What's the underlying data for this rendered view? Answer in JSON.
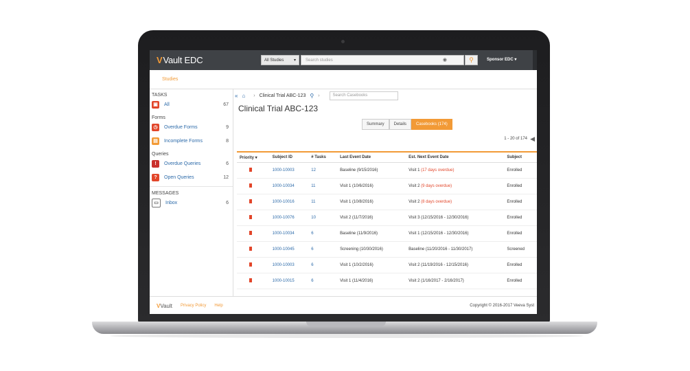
{
  "header": {
    "logo_mark": "V",
    "app_name": "Vault EDC",
    "study_select": "All Studies",
    "search_placeholder": "Search studies",
    "user_menu": "Sponsor EDC ▾"
  },
  "nav": {
    "studies": "Studies"
  },
  "sidebar": {
    "tasks_heading": "TASKS",
    "all": {
      "label": "All",
      "count": "67"
    },
    "forms_heading": "Forms",
    "overdue_forms": {
      "label": "Overdue Forms",
      "count": "9"
    },
    "incomplete_forms": {
      "label": "Incomplete Forms",
      "count": "8"
    },
    "queries_heading": "Queries",
    "overdue_queries": {
      "label": "Overdue Queries",
      "count": "6"
    },
    "open_queries": {
      "label": "Open Queries",
      "count": "12"
    },
    "messages_heading": "MESSAGES",
    "inbox": {
      "label": "Inbox",
      "count": "6"
    },
    "icon_colors": {
      "all": "#e2462a",
      "forms": "#e2462a",
      "incomplete": "#f29a36",
      "queries": "#c9302c",
      "inbox": "#777777"
    }
  },
  "breadcrumb": {
    "study": "Clinical Trial ABC-123",
    "case_search_placeholder": "Search Casebooks"
  },
  "page": {
    "title": "Clinical Trial ABC-123"
  },
  "tabs": {
    "summary": "Summary",
    "details": "Details",
    "casebooks": "Casebooks (174)"
  },
  "pager": {
    "text": "1 - 20 of 174"
  },
  "table": {
    "headers": [
      "Priority ▾",
      "Subject ID",
      "# Tasks",
      "Last Event Date",
      "Est. Next Event Date",
      "Subject"
    ],
    "rows": [
      {
        "id": "1000-10003",
        "tasks": "12",
        "last": "Baseline (9/15/2016)",
        "next": "Visit 1",
        "overdue": "(17 days overdue)",
        "status": "Enrolled"
      },
      {
        "id": "1000-10034",
        "tasks": "11",
        "last": "Visit 1 (10/6/2016)",
        "next": "Visit 2",
        "overdue": "(9 days overdue)",
        "status": "Enrolled"
      },
      {
        "id": "1000-10016",
        "tasks": "11",
        "last": "Visit 1 (10/8/2016)",
        "next": "Visit 2",
        "overdue": "(8 days overdue)",
        "status": "Enrolled"
      },
      {
        "id": "1000-10076",
        "tasks": "10",
        "last": "Visit 2 (11/7/2016)",
        "next": "Visit 3 (12/15/2016 - 12/30/2016)",
        "overdue": "",
        "status": "Enrolled"
      },
      {
        "id": "1000-10034",
        "tasks": "6",
        "last": "Baseline (11/9/2016)",
        "next": "Visit 1 (12/15/2016 - 12/30/2016)",
        "overdue": "",
        "status": "Enrolled"
      },
      {
        "id": "1000-10045",
        "tasks": "6",
        "last": "Screening (10/30/2016)",
        "next": "Baseline (11/20/2016 - 11/30/2017)",
        "overdue": "",
        "status": "Screened"
      },
      {
        "id": "1000-10003",
        "tasks": "6",
        "last": "Visit 1 (10/2/2016)",
        "next": "Visit 2 (11/19/2016 - 12/15/2016)",
        "overdue": "",
        "status": "Enrolled"
      },
      {
        "id": "1000-10015",
        "tasks": "6",
        "last": "Visit 1 (11/4/2016)",
        "next": "Visit 2 (1/16/2017 - 2/16/2017)",
        "overdue": "",
        "status": "Enrolled"
      }
    ]
  },
  "footer": {
    "logo": "Vault",
    "privacy": "Privacy Policy",
    "help": "Help",
    "copyright": "Copyright © 2016-2017 Veeva Syst"
  },
  "colors": {
    "accent": "#f29a36",
    "link": "#2c6aa9",
    "overdue": "#e2462a",
    "topbar": "#3f4246"
  }
}
